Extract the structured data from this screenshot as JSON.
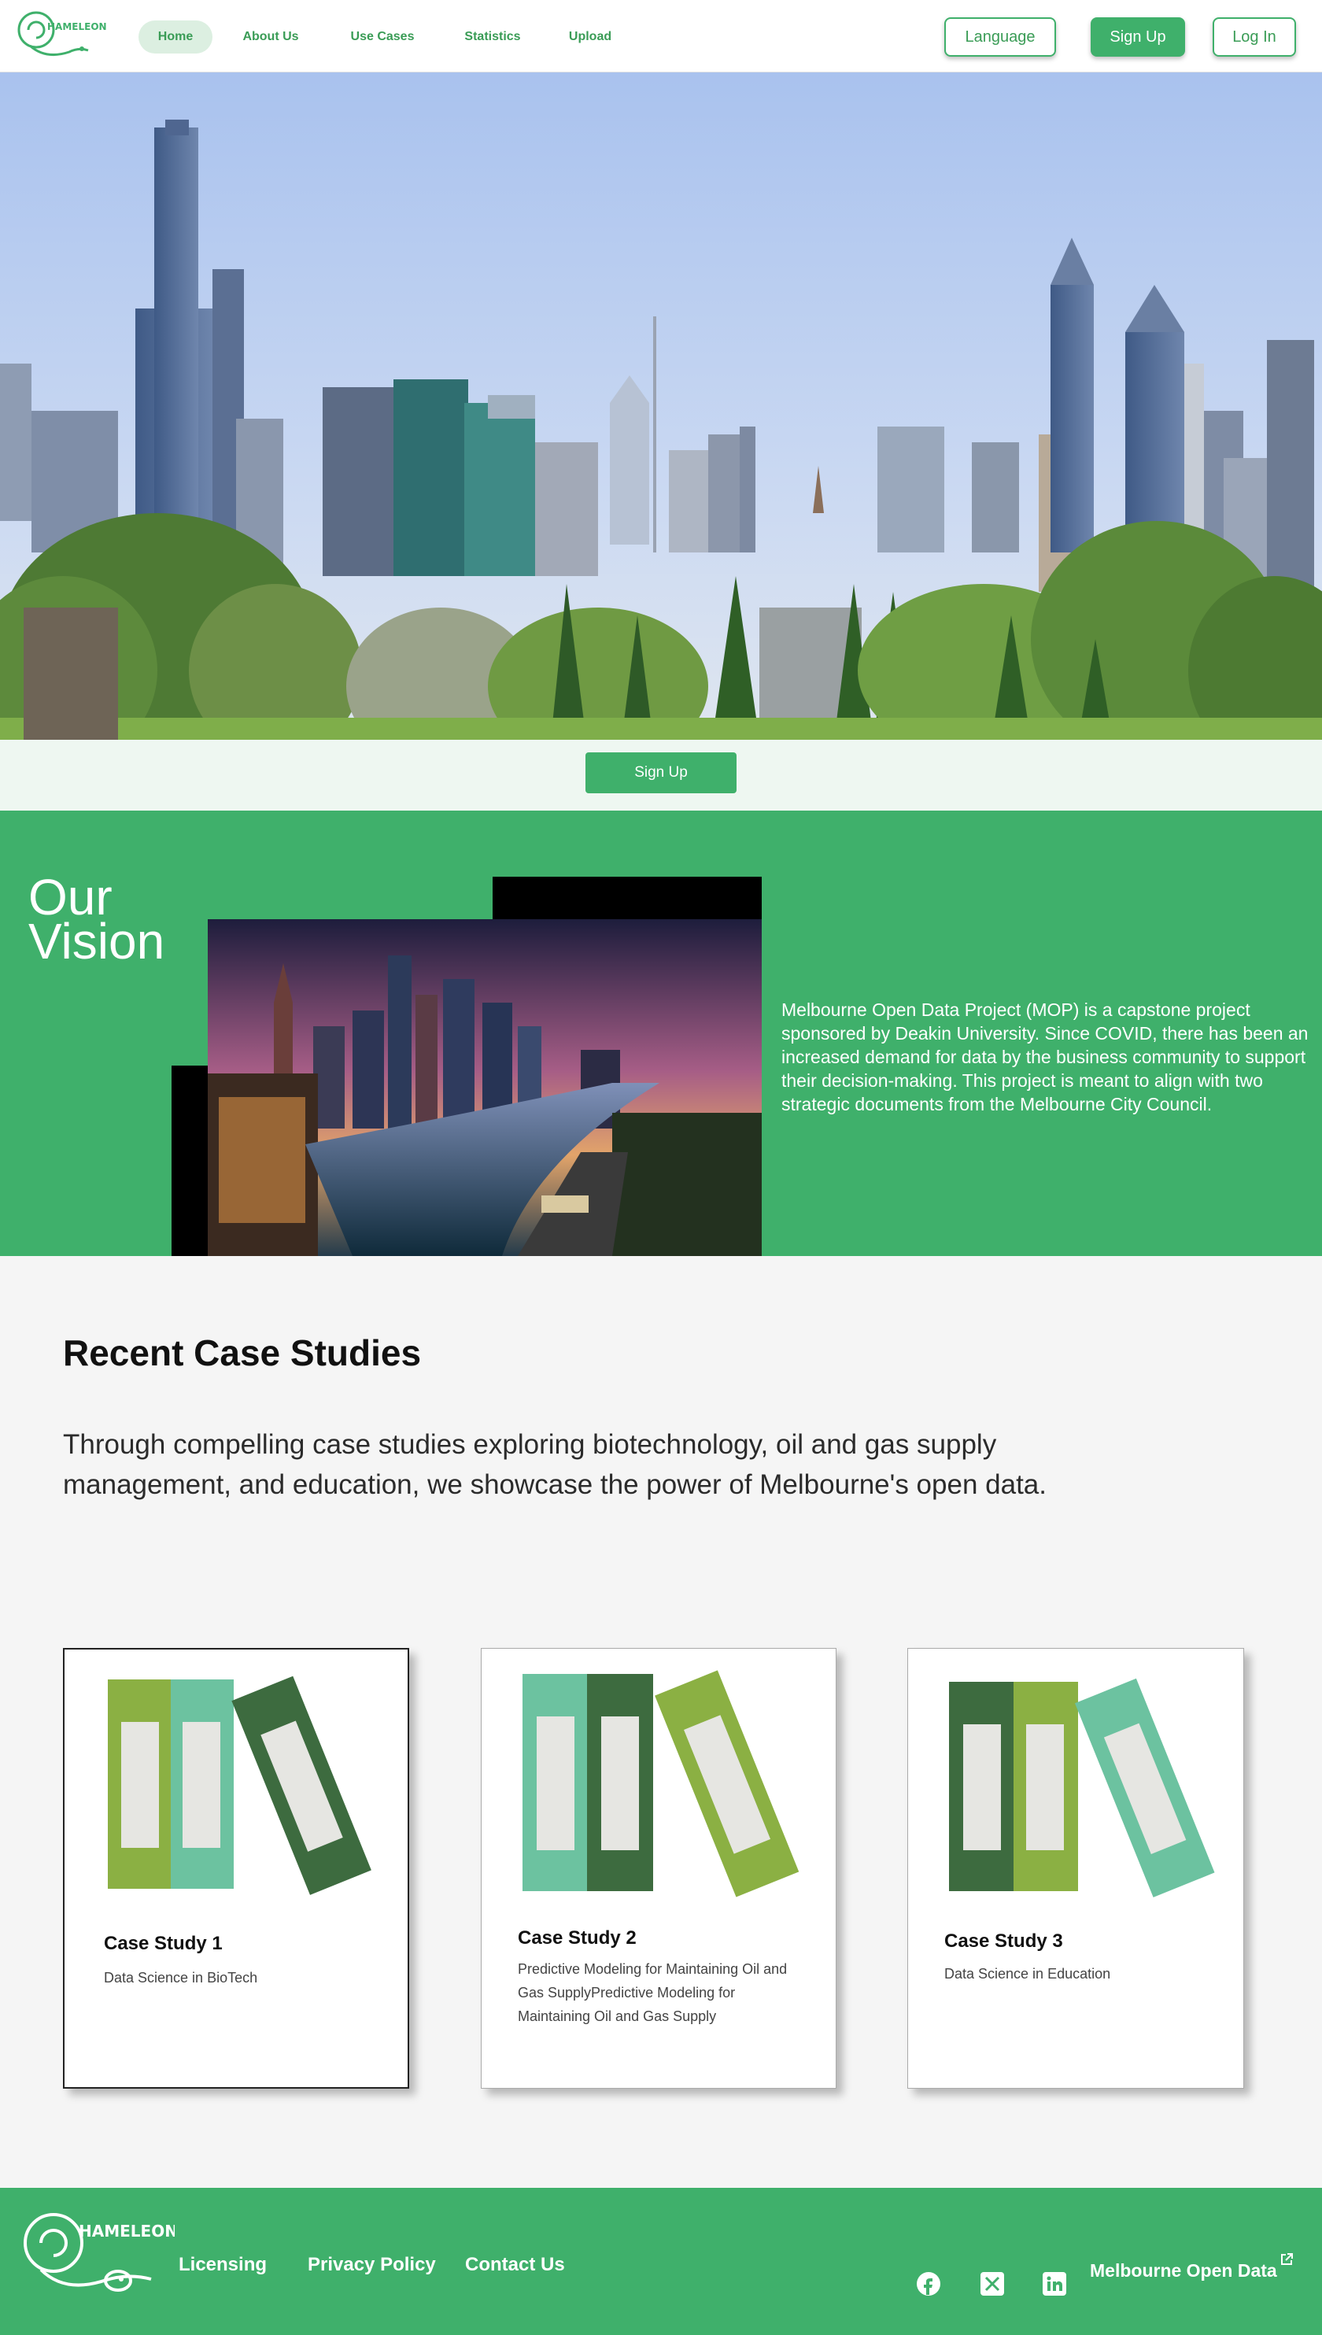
{
  "brand": {
    "logo_text": "HAMELEON"
  },
  "nav": {
    "links": [
      {
        "label": "Home",
        "active": true
      },
      {
        "label": "About Us",
        "active": false
      },
      {
        "label": "Use Cases",
        "active": false
      },
      {
        "label": "Statistics",
        "active": false
      },
      {
        "label": "Upload",
        "active": false
      }
    ],
    "language_label": "Language",
    "signup_label": "Sign Up",
    "login_label": "Log In"
  },
  "hero": {
    "image": "melbourne-skyline-photo",
    "signup_label": "Sign Up"
  },
  "vision": {
    "title_line1": "Our",
    "title_line2": "Vision",
    "image": "melbourne-night-river-illustration",
    "text": "Melbourne Open Data Project (MOP) is a capstone project sponsored by Deakin University. Since COVID, there has been an increased demand for data by the business community to support their decision-making. This project is meant to align with two strategic documents from the Melbourne City Council."
  },
  "case_studies": {
    "heading": "Recent Case Studies",
    "intro": "Through compelling case studies exploring biotechnology, oil and gas supply management, and education, we showcase the power of Melbourne's open data.",
    "cards": [
      {
        "title": "Case Study 1",
        "description": "Data Science in BioTech",
        "icon": "binders-icon"
      },
      {
        "title": "Case Study 2",
        "description": "Predictive Modeling for Maintaining Oil and Gas SupplyPredictive Modeling for Maintaining Oil and Gas Supply",
        "icon": "binders-icon"
      },
      {
        "title": "Case Study 3",
        "description": "Data Science in Education",
        "icon": "binders-icon"
      }
    ]
  },
  "footer": {
    "logo_text": "HAMELEON",
    "links": [
      "Licensing",
      "Privacy Policy",
      "Contact Us"
    ],
    "social": [
      "facebook-icon",
      "x-icon",
      "linkedin-icon"
    ],
    "external_link": "Melbourne Open Data"
  },
  "colors": {
    "brand_green": "#3fb06b",
    "binder_light_green": "#8bb043",
    "binder_teal": "#6cc2a0",
    "binder_dark_green": "#3d6b3f"
  }
}
